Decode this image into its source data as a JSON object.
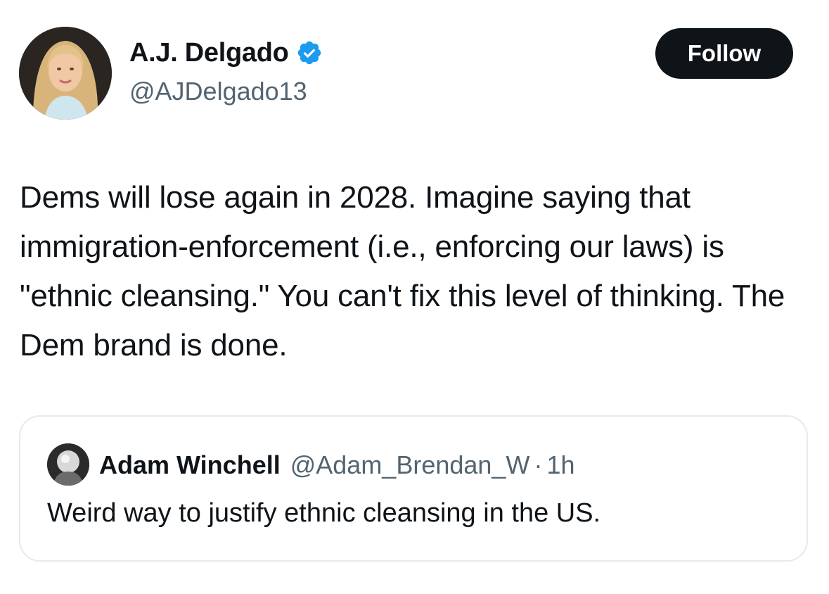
{
  "tweet": {
    "author": {
      "display_name": "A.J. Delgado",
      "handle": "@AJDelgado13",
      "verified": true,
      "verified_color": "#1d9bf0"
    },
    "follow_label": "Follow",
    "text": "Dems will lose again in 2028. Imagine saying that immigration-enforcement (i.e., enforcing our laws) is \"ethnic cleansing.\" You can't fix this level of thinking. The Dem brand is done."
  },
  "quoted_tweet": {
    "author": {
      "display_name": "Adam Winchell",
      "handle": "@Adam_Brendan_W"
    },
    "separator": "·",
    "time": "1h",
    "text": "Weird way to justify ethnic cleansing in the US."
  },
  "colors": {
    "text_primary": "#0f1419",
    "text_secondary": "#536471",
    "follow_button_bg": "#0f1419",
    "card_border": "#e6eaee"
  }
}
